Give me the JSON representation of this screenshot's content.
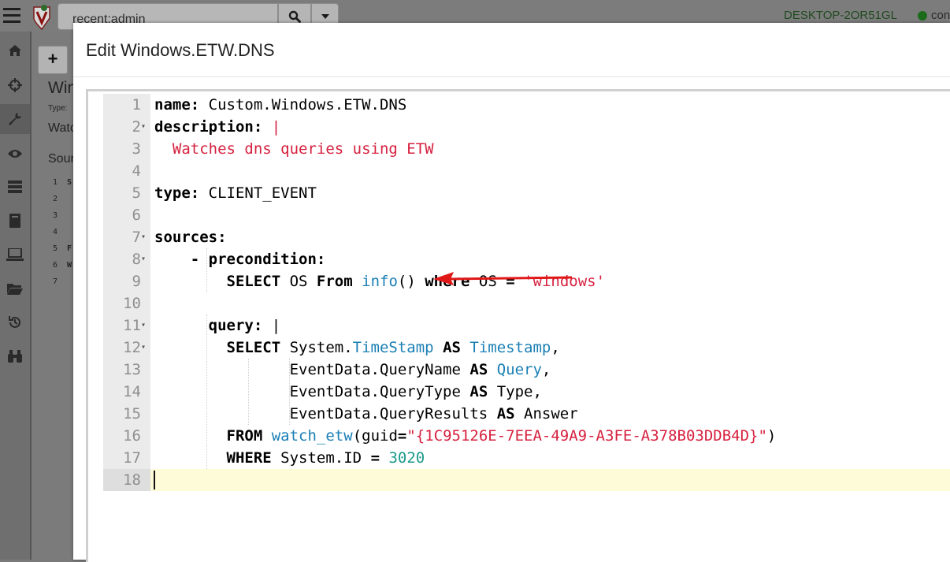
{
  "topbar": {
    "search_value": "recent:admin",
    "hostname": "DESKTOP-2OR51GL",
    "connection_label": "con"
  },
  "sidebar": {
    "items": [
      {
        "name": "home-icon"
      },
      {
        "name": "crosshair-icon"
      },
      {
        "name": "wrench-icon"
      },
      {
        "name": "eye-icon"
      },
      {
        "name": "server-icon"
      },
      {
        "name": "book-icon"
      },
      {
        "name": "laptop-icon"
      },
      {
        "name": "folder-icon"
      },
      {
        "name": "history-icon"
      },
      {
        "name": "binoculars-icon"
      }
    ]
  },
  "background_page": {
    "add_label": "+",
    "title": "Win",
    "type_label": "Type:",
    "desc": "Watc",
    "sources": "Sour",
    "lines": [
      "1",
      "2",
      "3",
      "4",
      "5",
      "6",
      "7"
    ],
    "code": [
      "S",
      "",
      "",
      "",
      "F",
      "W",
      ""
    ]
  },
  "modal": {
    "title": "Edit Windows.ETW.DNS"
  },
  "editor": {
    "lines": [
      {
        "n": "1",
        "fold": false,
        "tokens": [
          [
            "kw",
            "name:"
          ],
          [
            "plain",
            " Custom.Windows.ETW.DNS"
          ]
        ]
      },
      {
        "n": "2",
        "fold": true,
        "tokens": [
          [
            "kw",
            "description:"
          ],
          [
            "plain",
            " "
          ],
          [
            "str",
            "|"
          ]
        ]
      },
      {
        "n": "3",
        "fold": false,
        "tokens": [
          [
            "str",
            "  Watches dns queries using ETW"
          ]
        ]
      },
      {
        "n": "4",
        "fold": false,
        "tokens": []
      },
      {
        "n": "5",
        "fold": false,
        "tokens": [
          [
            "kw",
            "type:"
          ],
          [
            "plain",
            " CLIENT_EVENT"
          ]
        ]
      },
      {
        "n": "6",
        "fold": false,
        "tokens": []
      },
      {
        "n": "7",
        "fold": true,
        "tokens": [
          [
            "kw",
            "sources:"
          ]
        ]
      },
      {
        "n": "8",
        "fold": true,
        "tokens": [
          [
            "plain",
            "    "
          ],
          [
            "kw",
            "- precondition:"
          ]
        ]
      },
      {
        "n": "9",
        "fold": false,
        "tokens": [
          [
            "plain",
            "        "
          ],
          [
            "kw",
            "SELECT"
          ],
          [
            "plain",
            " OS "
          ],
          [
            "kw",
            "From"
          ],
          [
            "plain",
            " "
          ],
          [
            "fn",
            "info"
          ],
          [
            "plain",
            "() "
          ],
          [
            "kw",
            "where"
          ],
          [
            "plain",
            " OS "
          ],
          [
            "kw",
            "="
          ],
          [
            "plain",
            " "
          ],
          [
            "str",
            "'windows'"
          ]
        ]
      },
      {
        "n": "10",
        "fold": false,
        "tokens": []
      },
      {
        "n": "11",
        "fold": true,
        "tokens": [
          [
            "plain",
            "      "
          ],
          [
            "kw",
            "query:"
          ],
          [
            "plain",
            " |"
          ]
        ]
      },
      {
        "n": "12",
        "fold": true,
        "tokens": [
          [
            "plain",
            "        "
          ],
          [
            "kw",
            "SELECT"
          ],
          [
            "plain",
            " System."
          ],
          [
            "fn",
            "TimeStamp"
          ],
          [
            "plain",
            " "
          ],
          [
            "kw",
            "AS"
          ],
          [
            "plain",
            " "
          ],
          [
            "fn",
            "Timestamp"
          ],
          [
            "plain",
            ","
          ]
        ]
      },
      {
        "n": "13",
        "fold": false,
        "tokens": [
          [
            "plain",
            "               EventData.QueryName "
          ],
          [
            "kw",
            "AS"
          ],
          [
            "plain",
            " "
          ],
          [
            "fn",
            "Query"
          ],
          [
            "plain",
            ","
          ]
        ]
      },
      {
        "n": "14",
        "fold": false,
        "tokens": [
          [
            "plain",
            "               EventData.QueryType "
          ],
          [
            "kw",
            "AS"
          ],
          [
            "plain",
            " Type,"
          ]
        ]
      },
      {
        "n": "15",
        "fold": false,
        "tokens": [
          [
            "plain",
            "               EventData.QueryResults "
          ],
          [
            "kw",
            "AS"
          ],
          [
            "plain",
            " Answer"
          ]
        ]
      },
      {
        "n": "16",
        "fold": false,
        "tokens": [
          [
            "plain",
            "        "
          ],
          [
            "kw",
            "FROM"
          ],
          [
            "plain",
            " "
          ],
          [
            "fn",
            "watch_etw"
          ],
          [
            "plain",
            "(guid"
          ],
          [
            "kw",
            "="
          ],
          [
            "str",
            "\"{1C95126E-7EEA-49A9-A3FE-A378B03DDB4D}\""
          ],
          [
            "plain",
            ")"
          ]
        ]
      },
      {
        "n": "17",
        "fold": false,
        "tokens": [
          [
            "plain",
            "        "
          ],
          [
            "kw",
            "WHERE"
          ],
          [
            "plain",
            " System.ID "
          ],
          [
            "kw",
            "="
          ],
          [
            "plain",
            " "
          ],
          [
            "num",
            "3020"
          ]
        ]
      },
      {
        "n": "18",
        "fold": false,
        "active": true,
        "tokens": []
      }
    ]
  },
  "colors": {
    "keyword": "#000000",
    "string": "#d6213f",
    "function": "#1a7fb5",
    "number": "#1a9a8a",
    "arrow": "#e01818",
    "active_line": "#fefbd8"
  }
}
